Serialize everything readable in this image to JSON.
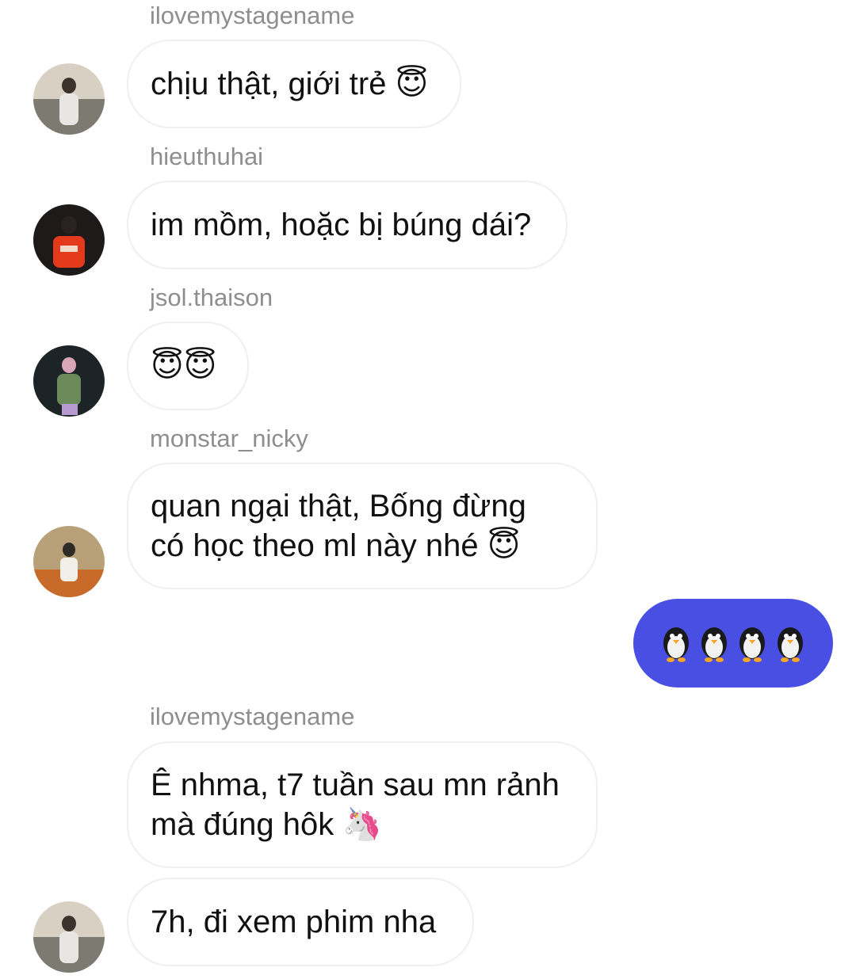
{
  "messages": [
    {
      "sender": "ilovemystagename",
      "text": "chịu thật, giới trẻ",
      "emoji": "😇"
    },
    {
      "sender": "hieuthuhai",
      "text": "im mồm, hoặc bị búng dái?"
    },
    {
      "sender": "jsol.thaison",
      "text": "",
      "emoji": "😇😇"
    },
    {
      "sender": "monstar_nicky",
      "line1": "quan ngại thật, Bống đừng",
      "line2": "có học theo ml này nhé",
      "emoji": "😇"
    },
    {
      "sender": "ilovemystagename",
      "line1": "Ê nhma, t7 tuần sau mn rảnh",
      "line2": "mà đúng hôk",
      "emoji": "🦄"
    },
    {
      "text": "7h, đi xem phim nha"
    }
  ],
  "outgoing": {
    "emoji": "🐧🐧🐧🐧"
  },
  "colors": {
    "outgoing_bubble": "#4a4fe4",
    "sender": "#8e8e8e",
    "bubble_border": "#efefef"
  }
}
